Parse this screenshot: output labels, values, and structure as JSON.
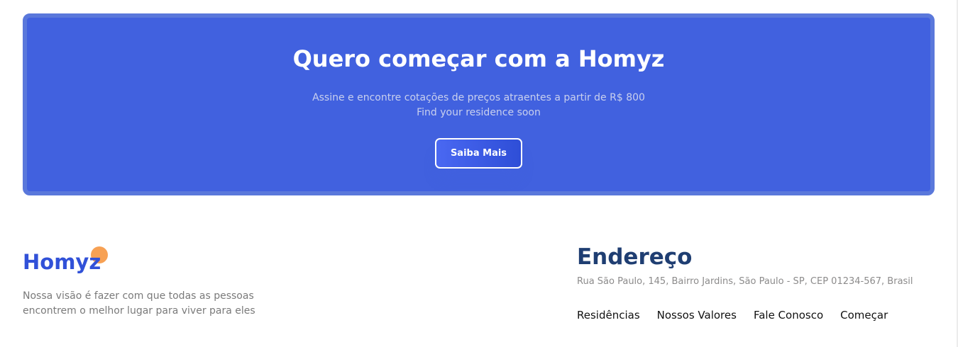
{
  "banner": {
    "title": "Quero começar com a Homyz",
    "subtitle_line1": "Assine e encontre cotações de preços atraentes a partir de R$ 800",
    "subtitle_line2": "Find your residence soon",
    "button_label": "Saiba Mais"
  },
  "footer": {
    "logo_text": "Homyz",
    "vision_text": "Nossa visão é fazer com que todas as pessoas encontrem o melhor lugar para viver para eles",
    "address_title": "Endereço",
    "address_text": "Rua São Paulo, 145, Bairro Jardins, São Paulo - SP, CEP 01234-567, Brasil",
    "nav": [
      {
        "label": "Residências"
      },
      {
        "label": "Nossos Valores"
      },
      {
        "label": "Fale Conosco"
      },
      {
        "label": "Começar"
      }
    ]
  },
  "colors": {
    "banner_bg": "#4161df",
    "banner_border": "#5a78db",
    "logo_blue": "#3151d8",
    "logo_dot": "#f7a154",
    "heading_navy": "#1f3e72"
  }
}
